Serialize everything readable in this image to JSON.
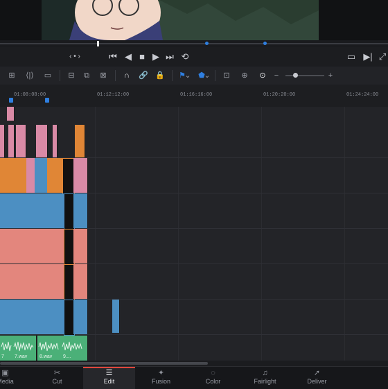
{
  "transport": {
    "nav_label": "‹ • ›",
    "icons": [
      "skip-start-icon",
      "step-back-icon",
      "stop-icon",
      "play-icon",
      "skip-end-icon",
      "loop-icon"
    ],
    "right_icons": [
      "fit-icon",
      "next-clip-icon",
      "full-screen-icon"
    ]
  },
  "toolbar": {
    "zoom_minus": "−",
    "zoom_plus": "+",
    "zoom_level": 0.4
  },
  "ruler": {
    "timecodes": [
      "01:08:08:00",
      "01:12:12:00",
      "01:16:16:00",
      "01:20:20:00",
      "01:24:24:00"
    ]
  },
  "audio_clips": [
    {
      "label": "7"
    },
    {
      "label": "7.wav"
    },
    {
      "label": "8.wav"
    },
    {
      "label": "9...."
    }
  ],
  "pages": [
    {
      "label": "Media",
      "icon": "media-icon"
    },
    {
      "label": "Cut",
      "icon": "cut-icon"
    },
    {
      "label": "Edit",
      "icon": "edit-icon",
      "active": true
    },
    {
      "label": "Fusion",
      "icon": "fusion-icon"
    },
    {
      "label": "Color",
      "icon": "color-icon"
    },
    {
      "label": "Fairlight",
      "icon": "fairlight-icon"
    },
    {
      "label": "Deliver",
      "icon": "deliver-icon"
    }
  ],
  "colors": {
    "pink": "#d98aa6",
    "orange": "#e08636",
    "blue": "#4c8fc2",
    "salmon": "#e3867d",
    "green": "#4bb078",
    "marker_blue": "#2f7fe0",
    "active_page": "#e0473d"
  }
}
